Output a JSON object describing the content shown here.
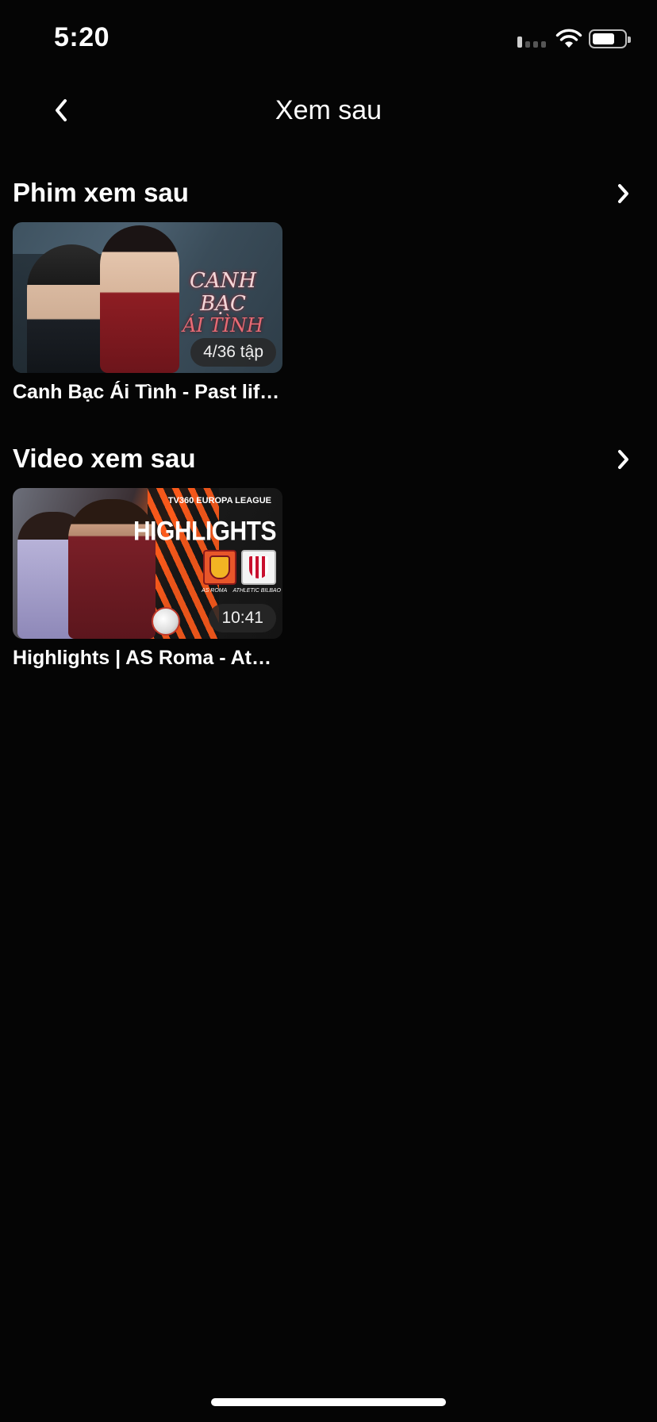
{
  "status_bar": {
    "time": "5:20"
  },
  "nav": {
    "title": "Xem sau"
  },
  "sections": [
    {
      "title": "Phim xem sau",
      "items": [
        {
          "title": "Canh Bạc Ái Tình - Past life,...",
          "badge": "4/36 tập",
          "thumb_text_line1": "CANH BẠC",
          "thumb_text_line2": "ÁI TÌNH"
        }
      ]
    },
    {
      "title": "Video xem sau",
      "items": [
        {
          "title": "Highlights | AS Roma - Athl...",
          "badge": "10:41",
          "thumb_brand": "TV360  EUROPA LEAGUE",
          "thumb_headline": "HIGHLIGHTS",
          "thumb_team1": "AS ROMA",
          "thumb_team2": "ATHLETIC BILBAO"
        }
      ]
    }
  ],
  "colors": {
    "background": "#050505",
    "text": "#ffffff",
    "badge_bg": "#282828"
  }
}
